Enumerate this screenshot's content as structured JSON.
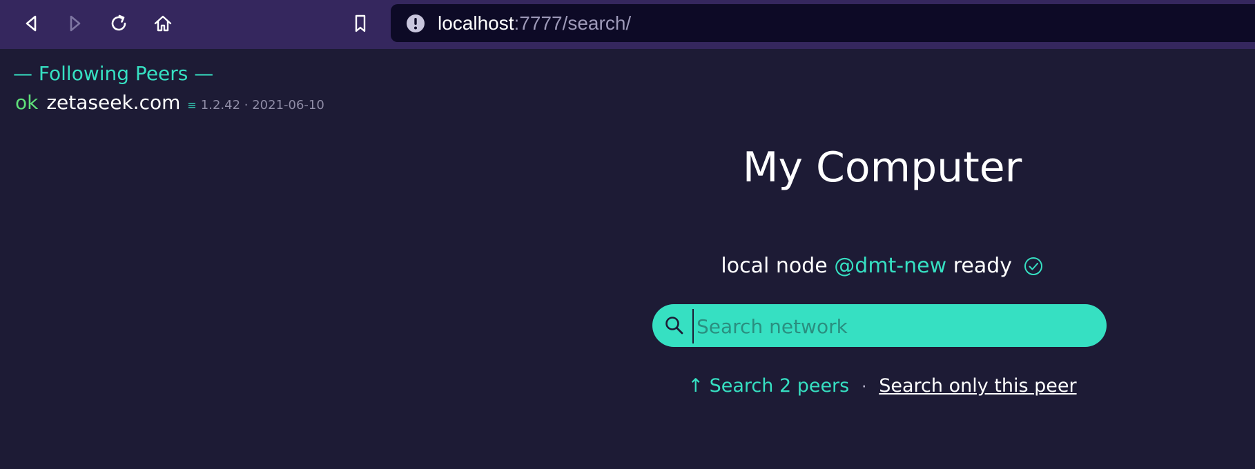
{
  "browser": {
    "url_host": "localhost",
    "url_rest": ":7777/search/",
    "icons": [
      "back-icon",
      "forward-icon",
      "reload-icon",
      "home-icon",
      "bookmark-icon",
      "site-info-icon"
    ]
  },
  "sidebar": {
    "heading": "— Following Peers —",
    "peers": [
      {
        "status": "ok",
        "host": "zetaseek.com",
        "menu_glyph": "≡",
        "meta": "1.2.42 · 2021-06-10"
      }
    ]
  },
  "main": {
    "title": "My Computer",
    "status_prefix": "local node",
    "node_name": "@dmt-new",
    "status_suffix": "ready",
    "search": {
      "placeholder": "Search network",
      "value": ""
    },
    "links": {
      "search_peers": "↑ Search 2 peers",
      "separator": "·",
      "search_this": "Search only this peer"
    }
  },
  "colors": {
    "accent": "#36e0c2",
    "ok": "#5fe07a",
    "background": "#1d1b35",
    "toolbar": "#35275e"
  }
}
